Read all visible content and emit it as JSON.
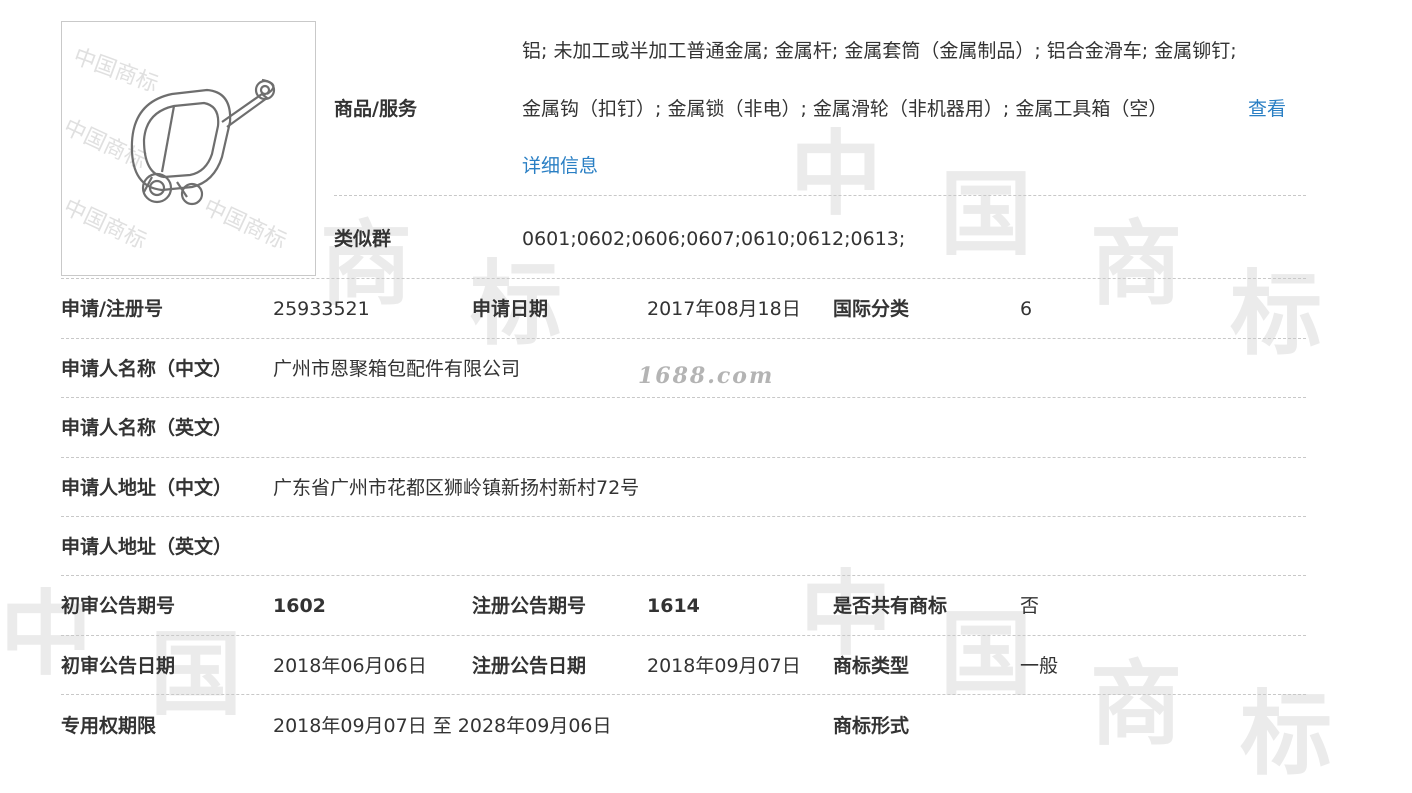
{
  "watermark_text": "1688.com",
  "trademark_image": {
    "alt": "trademark logo: wheeled luggage frame",
    "stamp_text": "中国商标"
  },
  "goods": {
    "label": "商品/服务",
    "line1": "铝; 未加工或半加工普通金属; 金属杆; 金属套筒（金属制品）; 铝合金滑车; 金属铆钉;",
    "line2": "金属钩（扣钉）; 金属锁（非电）; 金属滑轮（非机器用）; 金属工具箱（空）",
    "more_link_1": "查看",
    "more_link_2": "详细信息"
  },
  "similar_group": {
    "label": "类似群",
    "value": "0601;0602;0606;0607;0610;0612;0613;"
  },
  "reg_no": {
    "label": "申请/注册号",
    "value": "25933521"
  },
  "apply_date": {
    "label": "申请日期",
    "value": "2017年08月18日"
  },
  "intl_class": {
    "label": "国际分类",
    "value": "6"
  },
  "applicant_cn": {
    "label": "申请人名称（中文）",
    "value": "广州市恩聚箱包配件有限公司"
  },
  "applicant_en": {
    "label": "申请人名称（英文）",
    "value": ""
  },
  "address_cn": {
    "label": "申请人地址（中文）",
    "value": "广东省广州市花都区狮岭镇新扬村新村72号"
  },
  "address_en": {
    "label": "申请人地址（英文）",
    "value": ""
  },
  "prelim_issue": {
    "label": "初审公告期号",
    "value": "1602"
  },
  "reg_issue": {
    "label": "注册公告期号",
    "value": "1614"
  },
  "shared": {
    "label": "是否共有商标",
    "value": "否"
  },
  "prelim_date": {
    "label": "初审公告日期",
    "value": "2018年06月06日"
  },
  "reg_date": {
    "label": "注册公告日期",
    "value": "2018年09月07日"
  },
  "mark_type": {
    "label": "商标类型",
    "value": "一般"
  },
  "exclusive_period": {
    "label": "专用权期限",
    "value": "2018年09月07日 至 2028年09月06日"
  },
  "mark_form": {
    "label": "商标形式",
    "value": ""
  },
  "colors": {
    "link": "#2a7fc4",
    "divider": "#c8c8c8",
    "watermark": "#ebebeb"
  }
}
